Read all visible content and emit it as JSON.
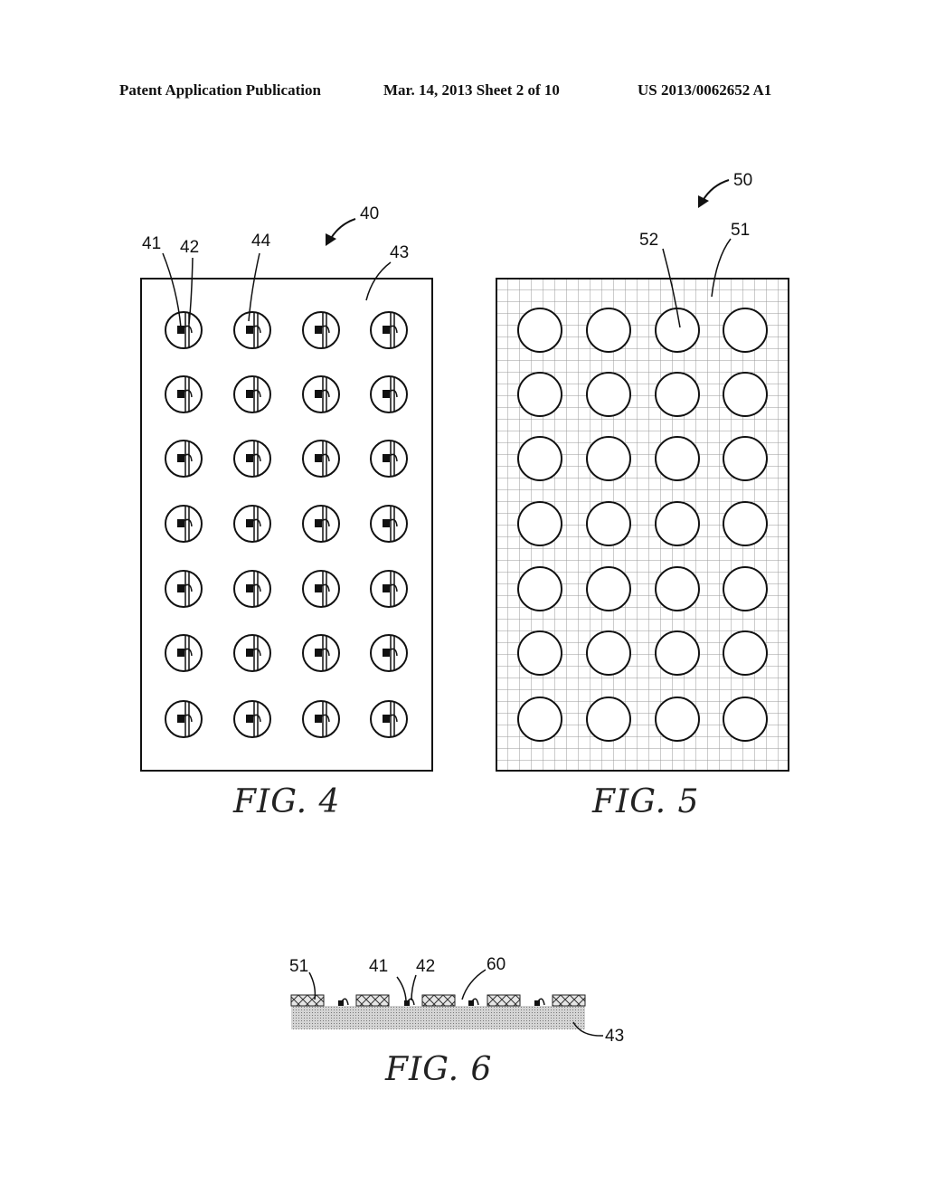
{
  "header": {
    "left": "Patent Application Publication",
    "center": "Mar. 14, 2013  Sheet 2 of 10",
    "right": "US 2013/0062652 A1"
  },
  "figures": {
    "fig4": {
      "label": "FIG. 4",
      "refs": {
        "assembly": "40",
        "led": "41",
        "wire": "42",
        "substrate": "43",
        "element": "44"
      },
      "rows": 7,
      "cols": 4
    },
    "fig5": {
      "label": "FIG. 5",
      "refs": {
        "assembly": "50",
        "mesh": "51",
        "opening": "52"
      },
      "rows": 7,
      "cols": 4
    },
    "fig6": {
      "label": "FIG. 6",
      "refs": {
        "mesh": "51",
        "led": "41",
        "wire": "42",
        "gap": "60",
        "substrate": "43"
      }
    }
  },
  "colors": {
    "ink": "#111111",
    "grid": "#9a9a9a",
    "substrate": "#bdbdbd"
  }
}
